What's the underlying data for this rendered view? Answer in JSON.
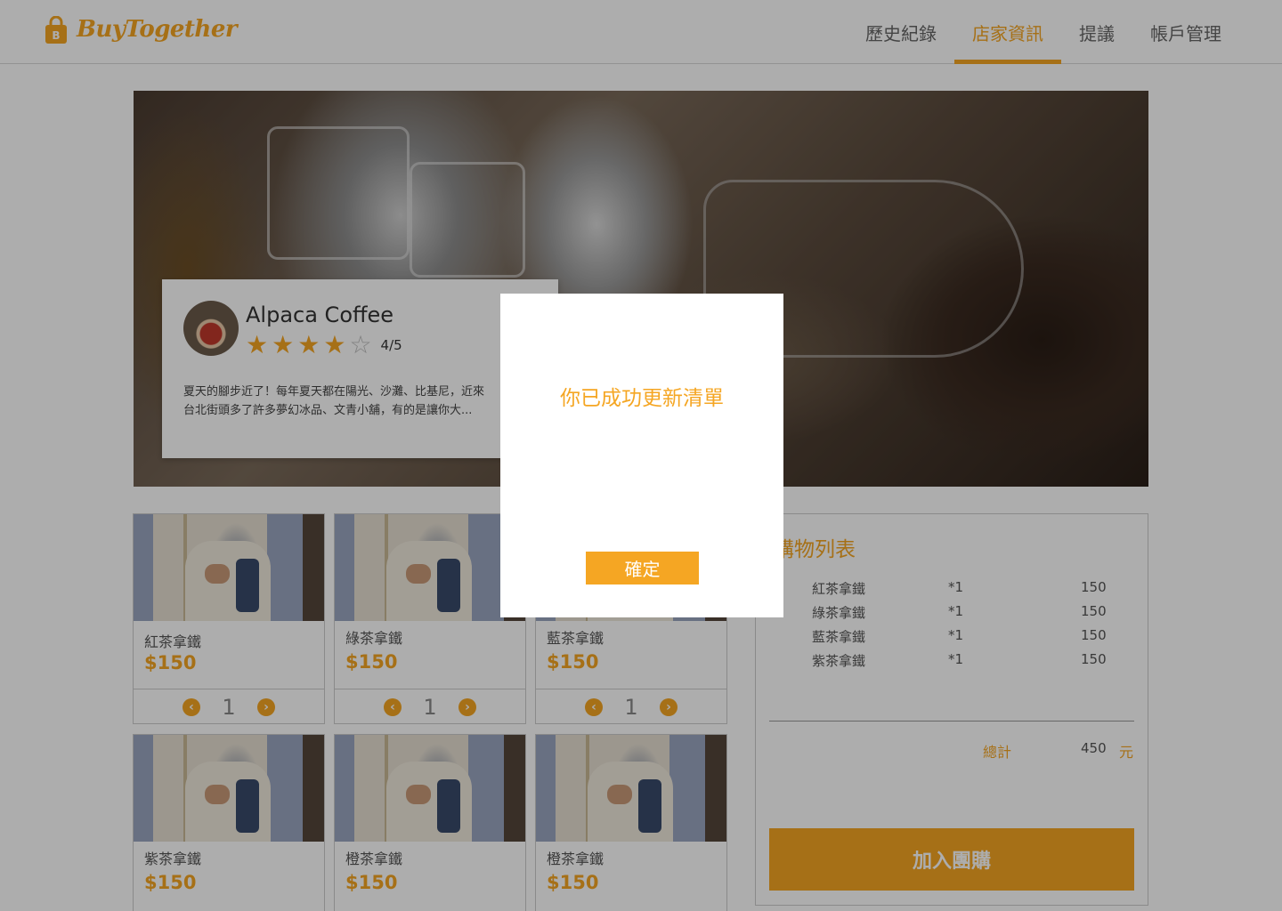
{
  "app": {
    "brand": "BuyTogether"
  },
  "nav": {
    "items": [
      {
        "label": "歷史紀錄",
        "active": false
      },
      {
        "label": "店家資訊",
        "active": true
      },
      {
        "label": "提議",
        "active": false
      },
      {
        "label": "帳戶管理",
        "active": false
      }
    ]
  },
  "store": {
    "name": "Alpaca Coffee",
    "rating_value": 4,
    "rating_max": 5,
    "rating_text": "4/5",
    "description": "夏天的腳步近了！每年夏天都在陽光、沙灘、比基尼，近來台北街頭多了許多夢幻冰品、文青小舖，有的是讓你大..."
  },
  "products": [
    {
      "name": "紅茶拿鐵",
      "price": "$150",
      "qty": "1"
    },
    {
      "name": "綠茶拿鐵",
      "price": "$150",
      "qty": "1"
    },
    {
      "name": "藍茶拿鐵",
      "price": "$150",
      "qty": "1"
    },
    {
      "name": "紫茶拿鐵",
      "price": "$150"
    },
    {
      "name": "橙茶拿鐵",
      "price": "$150"
    },
    {
      "name": "橙茶拿鐵",
      "price": "$150"
    }
  ],
  "cart": {
    "title": "購物列表",
    "items": [
      {
        "name": "紅茶拿鐵",
        "qty": "*1",
        "price": "150"
      },
      {
        "name": "綠茶拿鐵",
        "qty": "*1",
        "price": "150"
      },
      {
        "name": "藍茶拿鐵",
        "qty": "*1",
        "price": "150"
      },
      {
        "name": "紫茶拿鐵",
        "qty": "*1",
        "price": "150"
      }
    ],
    "total_label": "總計",
    "total_value": "450",
    "total_unit": "元",
    "join_label": "加入團購"
  },
  "modal": {
    "message": "你已成功更新清單",
    "confirm_label": "確定"
  },
  "colors": {
    "accent": "#f5a623",
    "overlay": "rgba(0,0,0,0.32)"
  }
}
